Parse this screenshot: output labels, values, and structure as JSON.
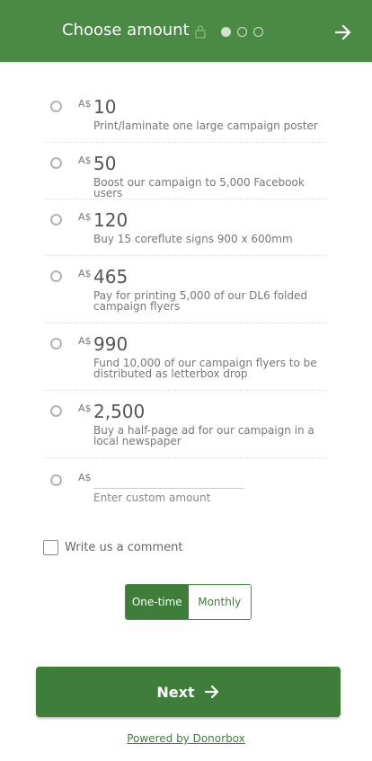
{
  "header": {
    "title": "Choose amount",
    "steps": 3,
    "active_step": 1
  },
  "options": [
    {
      "currency": "A$",
      "amount": "10",
      "description": "Print/laminate one large campaign poster"
    },
    {
      "currency": "A$",
      "amount": "50",
      "description": "Boost our campaign to 5,000 Facebook users"
    },
    {
      "currency": "A$",
      "amount": "120",
      "description": "Buy 15 coreflute signs 900 x 600mm"
    },
    {
      "currency": "A$",
      "amount": "465",
      "description": "Pay for printing 5,000 of our DL6 folded campaign flyers"
    },
    {
      "currency": "A$",
      "amount": "990",
      "description": "Fund 10,000 of our campaign flyers to be distributed as letterbox drop"
    },
    {
      "currency": "A$",
      "amount": "2,500",
      "description": "Buy a half-page ad for our campaign in a local newspaper"
    }
  ],
  "custom": {
    "currency": "A$",
    "placeholder": "Enter custom amount"
  },
  "comment": {
    "label": "Write us a comment"
  },
  "frequency": {
    "one_time": "One-time",
    "monthly": "Monthly",
    "selected": "One-time"
  },
  "next_label": "Next",
  "powered_by": "Powered by Donorbox",
  "colors": {
    "brand": "#4a8a45",
    "button": "#3e7e3a"
  },
  "icons": {
    "lock": "lock-icon",
    "next": "arrow-right-icon"
  }
}
